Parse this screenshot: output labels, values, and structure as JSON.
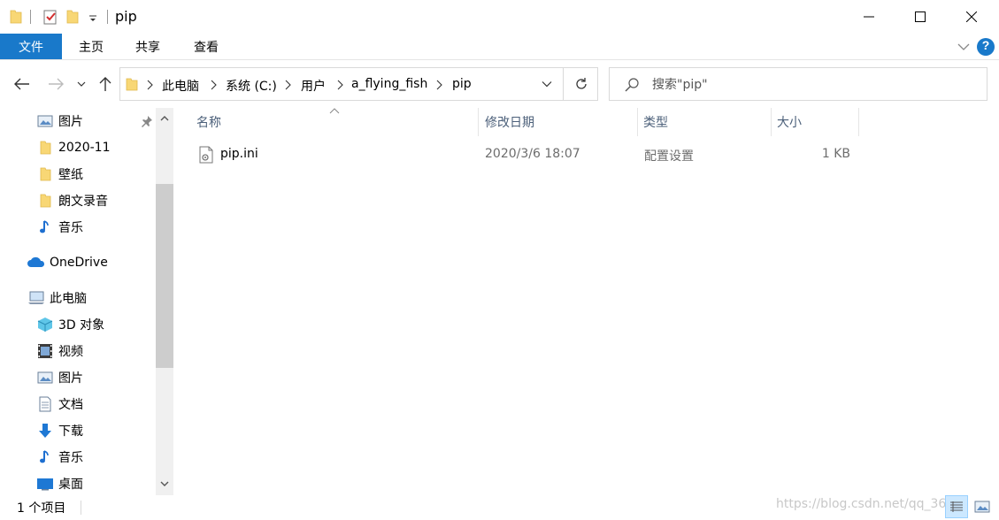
{
  "window": {
    "title": "pip",
    "minimize_glyph": "—",
    "maximize_glyph": "☐",
    "close_glyph": "✕"
  },
  "ribbon": {
    "tabs": [
      {
        "label": "文件"
      },
      {
        "label": "主页"
      },
      {
        "label": "共享"
      },
      {
        "label": "查看"
      }
    ],
    "help_label": "?"
  },
  "address": {
    "crumbs": [
      "此电脑",
      "系统 (C:)",
      "用户",
      "a_flying_fish",
      "pip"
    ]
  },
  "search": {
    "placeholder": "搜索\"pip\""
  },
  "nav": {
    "items": [
      {
        "label": "图片",
        "icon": "pictures-icon"
      },
      {
        "label": "2020-11",
        "icon": "folder-icon"
      },
      {
        "label": "壁纸",
        "icon": "folder-icon"
      },
      {
        "label": "朗文录音",
        "icon": "folder-icon"
      },
      {
        "label": "音乐",
        "icon": "music-icon"
      },
      {
        "label": "OneDrive",
        "icon": "onedrive-icon"
      },
      {
        "label": "此电脑",
        "icon": "this-pc-icon"
      },
      {
        "label": "3D 对象",
        "icon": "3d-objects-icon"
      },
      {
        "label": "视频",
        "icon": "videos-icon"
      },
      {
        "label": "图片",
        "icon": "pictures-icon"
      },
      {
        "label": "文档",
        "icon": "documents-icon"
      },
      {
        "label": "下载",
        "icon": "downloads-icon"
      },
      {
        "label": "音乐",
        "icon": "music-icon"
      },
      {
        "label": "桌面",
        "icon": "desktop-icon"
      }
    ]
  },
  "columns": {
    "name": "名称",
    "date": "修改日期",
    "type": "类型",
    "size": "大小"
  },
  "files": [
    {
      "name": "pip.ini",
      "date": "2020/3/6 18:07",
      "type": "配置设置",
      "size": "1 KB"
    }
  ],
  "status": {
    "count_text": "1 个项目",
    "watermark": "https://blog.csdn.net/qq_36"
  },
  "colors": {
    "accent": "#1979ca",
    "folder": "#f8d775",
    "header_text": "#4c607a"
  }
}
